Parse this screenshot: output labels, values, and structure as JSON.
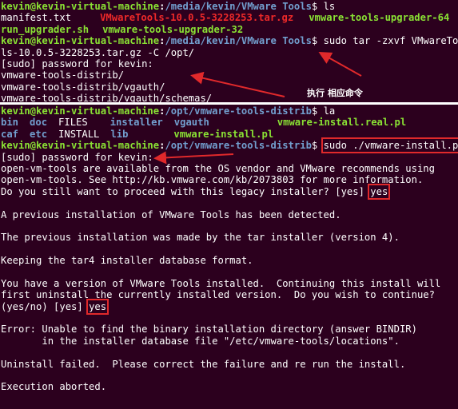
{
  "terminal_top": {
    "lines": [
      {
        "user": "kevin@kevin-virtual-machine",
        "path": "/media/kevin/VMware Tools",
        "cmd": " ls"
      },
      {
        "items": [
          {
            "text": "manifest.txt",
            "cls": "plain"
          },
          {
            "text": "VMwareTools-10.0.5-3228253.tar.gz",
            "cls": "red"
          },
          {
            "text": "vmware-tools-upgrader-64",
            "cls": "green"
          }
        ]
      },
      {
        "items": [
          {
            "text": "run_upgrader.sh",
            "cls": "green"
          },
          {
            "text": "vmware-tools-upgrader-32",
            "cls": "green"
          }
        ]
      },
      {
        "user": "kevin@kevin-virtual-machine",
        "path": "/media/kevin/VMware Tools",
        "cmd": " sudo tar -zxvf VMwareToo"
      },
      {
        "text": "ls-10.0.5-3228253.tar.gz -C /opt/"
      },
      {
        "text": "[sudo] password for kevin:"
      },
      {
        "text": "vmware-tools-distrib/"
      },
      {
        "text": "vmware-tools-distrib/vgauth/"
      },
      {
        "text": "vmware-tools-distrib/vgauth/schemas/"
      }
    ],
    "annotation": "执行 相应命令"
  },
  "terminal_bottom": {
    "prompt_user": "kevin@kevin-virtual-machine",
    "prompt_path": "/opt/vmware-tools-distrib",
    "cmd_la": " la",
    "ls_row1": [
      "bin",
      "doc",
      "FILES",
      "installer",
      "vgauth",
      "vmware-install.real.pl"
    ],
    "ls_row2": [
      "caf",
      "etc",
      "INSTALL",
      "lib",
      "vmware-install.pl"
    ],
    "cmd_install": "sudo ./vmware-install.pl",
    "output": [
      "[sudo] password for kevin:",
      "open-vm-tools are available from the OS vendor and VMware recommends using",
      "open-vm-tools. See http://kb.vmware.com/kb/2073803 for more information.",
      "Do you still want to proceed with this legacy installer? [yes] ",
      "",
      "A previous installation of VMware Tools has been detected.",
      "",
      "The previous installation was made by the tar installer (version 4).",
      "",
      "Keeping the tar4 installer database format.",
      "",
      "You have a version of VMware Tools installed.  Continuing this install will",
      "first uninstall the currently installed version.  Do you wish to continue?",
      "(yes/no) [yes] ",
      "",
      "Error: Unable to find the binary installation directory (answer BINDIR)",
      "       in the installer database file \"/etc/vmware-tools/locations\".",
      "",
      "Uninstall failed.  Please correct the failure and re run the install.",
      "",
      "Execution aborted."
    ],
    "answer1": "yes",
    "answer2": "yes"
  },
  "colors": {
    "background": "#2c001e",
    "prompt": "#8ae234",
    "path": "#729fcf",
    "highlight": "#e0292b"
  }
}
